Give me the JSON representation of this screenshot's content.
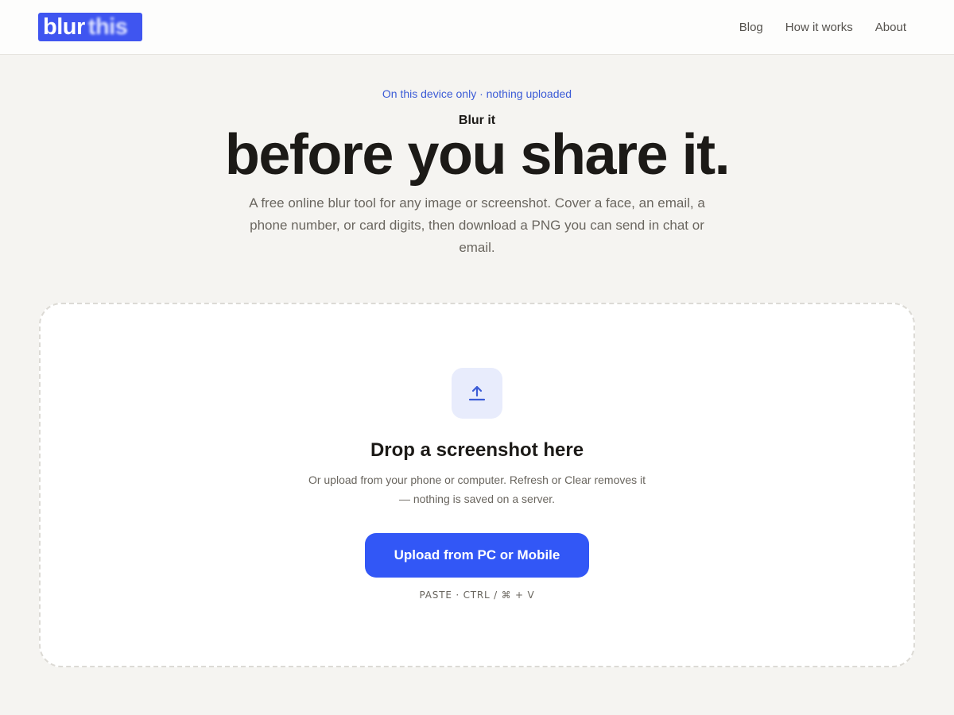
{
  "header": {
    "logo": {
      "plain": "blur",
      "blurred": "this"
    },
    "nav": [
      {
        "label": "Blog"
      },
      {
        "label": "How it works"
      },
      {
        "label": "About"
      }
    ]
  },
  "hero": {
    "eyebrow": "On this device only · nothing uploaded",
    "kicker": "Blur it",
    "headline": "before you share it.",
    "subtext": "A free online blur tool for any image or screenshot. Cover a face, an email, a phone number, or card digits, then download a PNG you can send in chat or email."
  },
  "dropzone": {
    "icon": "upload-icon",
    "title": "Drop a screenshot here",
    "description": "Or upload from your phone or computer. Refresh or Clear removes it — nothing is saved on a server.",
    "button_label": "Upload from PC or Mobile",
    "paste_hint": "PASTE · CTRL / ⌘ + V"
  },
  "colors": {
    "accent": "#3257f6",
    "logo_bg": "#3f55f0",
    "eyebrow": "#3b5bd6",
    "page_bg": "#f5f4f1",
    "icon_tile_bg": "#e8ecfc"
  }
}
